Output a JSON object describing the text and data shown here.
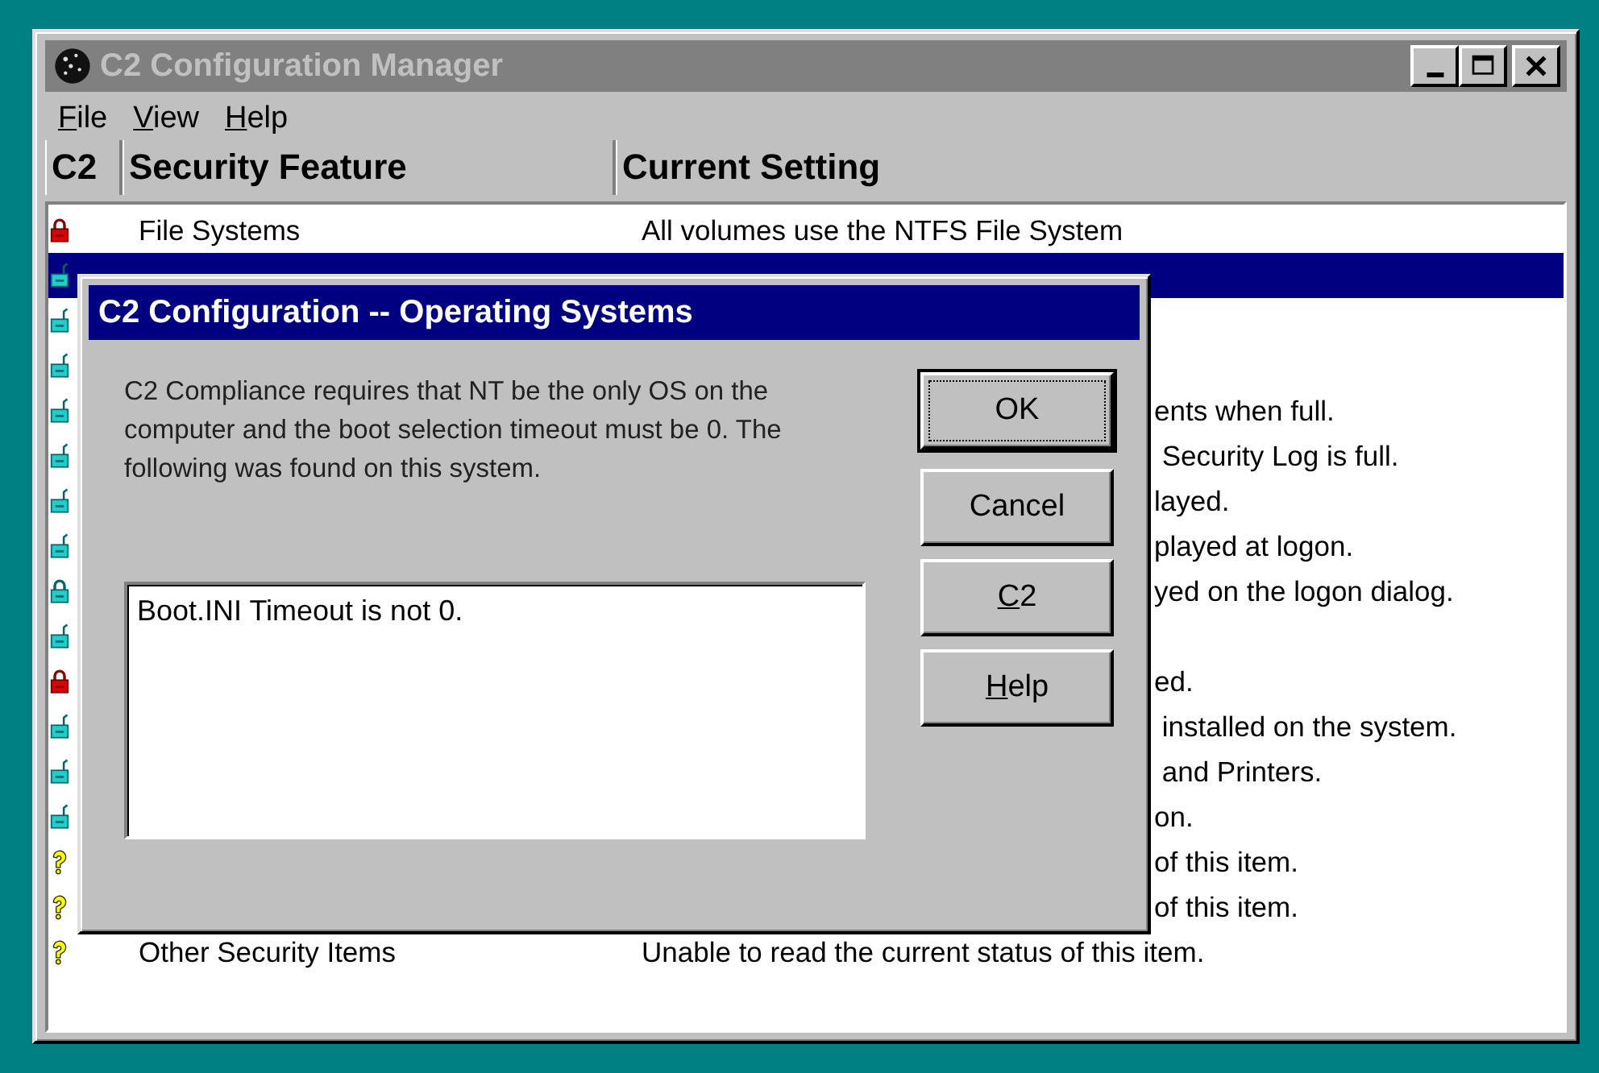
{
  "window": {
    "title": "C2 Configuration Manager"
  },
  "menu": [
    {
      "label": "File",
      "mnemonic": true
    },
    {
      "label": "View",
      "mnemonic": true
    },
    {
      "label": "Help",
      "mnemonic": true
    }
  ],
  "table": {
    "columns": [
      "C2",
      "Security Feature",
      "Current Setting"
    ],
    "rows": [
      {
        "kind": "secure",
        "feature": "File Systems",
        "setting": "All volumes use the NTFS File System",
        "clipped": false,
        "selected": false
      },
      {
        "kind": "open",
        "feature": "",
        "setting": "",
        "selected": true
      },
      {
        "kind": "open",
        "feature": "",
        "setting": "",
        "selected": false
      },
      {
        "kind": "open",
        "feature": "",
        "setting": "",
        "selected": false
      },
      {
        "kind": "open",
        "feature": "",
        "setting": "ents when full.",
        "clipped": true,
        "selected": false
      },
      {
        "kind": "open",
        "feature": "",
        "setting": " Security Log is full.",
        "clipped": true,
        "selected": false
      },
      {
        "kind": "open",
        "feature": "",
        "setting": "layed.",
        "clipped": true,
        "selected": false
      },
      {
        "kind": "open",
        "feature": "",
        "setting": "played at logon.",
        "clipped": true,
        "selected": false
      },
      {
        "kind": "closed",
        "feature": "",
        "setting": "yed on the logon dialog.",
        "clipped": true,
        "selected": false
      },
      {
        "kind": "open",
        "feature": "",
        "setting": "",
        "selected": false
      },
      {
        "kind": "secure",
        "feature": "",
        "setting": "ed.",
        "clipped": true,
        "selected": false
      },
      {
        "kind": "open",
        "feature": "",
        "setting": " installed on the system.",
        "clipped": true,
        "selected": false
      },
      {
        "kind": "open",
        "feature": "",
        "setting": " and Printers.",
        "clipped": true,
        "selected": false
      },
      {
        "kind": "open",
        "feature": "",
        "setting": "on.",
        "clipped": true,
        "selected": false
      },
      {
        "kind": "unknown",
        "feature": "",
        "setting": "of this item.",
        "clipped": true,
        "selected": false
      },
      {
        "kind": "unknown",
        "feature": "",
        "setting": "of this item.",
        "clipped": true,
        "selected": false
      },
      {
        "kind": "unknown",
        "feature": "Other Security Items",
        "setting": "Unable to read the current status of this item.",
        "clipped": false,
        "selected": false
      }
    ]
  },
  "dialog": {
    "title": "C2 Configuration -- Operating Systems",
    "message": "C2 Compliance requires that NT be the only OS on the computer and the boot selection timeout must be 0. The following was found on this system.",
    "findings": [
      "Boot.INI Timeout is not 0."
    ],
    "buttons": [
      {
        "label": "OK",
        "default": true,
        "mnemonic": false
      },
      {
        "label": "Cancel",
        "default": false,
        "mnemonic": false
      },
      {
        "label": "C2",
        "default": false,
        "mnemonic": true
      },
      {
        "label": "Help",
        "default": false,
        "mnemonic": true
      }
    ]
  }
}
